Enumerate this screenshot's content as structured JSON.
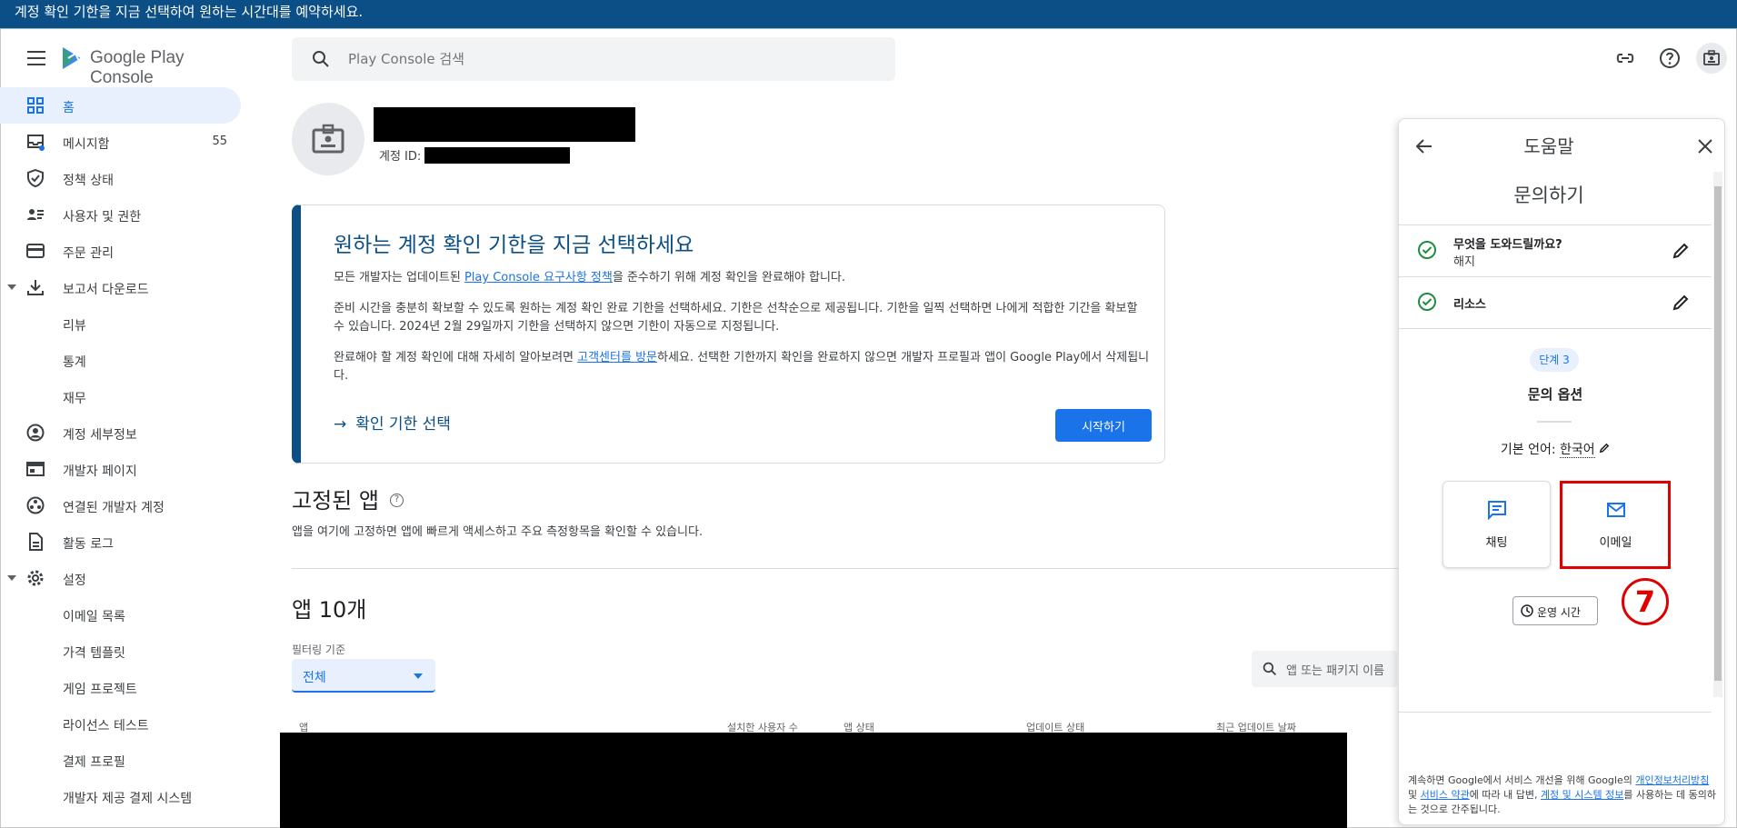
{
  "banner": {
    "text": "계정 확인 기한을 지금 선택하여 원하는 시간대를 예약하세요."
  },
  "brand": {
    "name": "Google Play Console"
  },
  "search": {
    "placeholder": "Play Console 검색"
  },
  "nav": [
    {
      "label": "홈",
      "icon": "home-grid-icon",
      "active": true
    },
    {
      "label": "메시지함",
      "icon": "inbox-icon",
      "count": "55"
    },
    {
      "label": "정책 상태",
      "icon": "shield-check-icon"
    },
    {
      "label": "사용자 및 권한",
      "icon": "users-icon"
    },
    {
      "label": "주문 관리",
      "icon": "card-icon"
    },
    {
      "label": "보고서 다운로드",
      "icon": "download-icon",
      "expandable": true
    },
    {
      "label": "리뷰",
      "sub": true
    },
    {
      "label": "통계",
      "sub": true
    },
    {
      "label": "재무",
      "sub": true
    },
    {
      "label": "계정 세부정보",
      "icon": "account-circle-icon"
    },
    {
      "label": "개발자 페이지",
      "icon": "web-page-icon"
    },
    {
      "label": "연결된 개발자 계정",
      "icon": "linked-accounts-icon"
    },
    {
      "label": "활동 로그",
      "icon": "log-icon"
    },
    {
      "label": "설정",
      "icon": "gear-icon",
      "expandable": true
    },
    {
      "label": "이메일 목록",
      "sub": true
    },
    {
      "label": "가격 템플릿",
      "sub": true
    },
    {
      "label": "게임 프로젝트",
      "sub": true
    },
    {
      "label": "라이선스 테스트",
      "sub": true
    },
    {
      "label": "결제 프로필",
      "sub": true
    },
    {
      "label": "개발자 제공 결제 시스템",
      "sub": true
    }
  ],
  "account": {
    "id_label": "계정 ID:"
  },
  "card": {
    "title": "원하는 계정 확인 기한을 지금 선택하세요",
    "p1_pre": "모든 개발자는 업데이트된 ",
    "p1_link": "Play Console 요구사항 정책",
    "p1_post": "을 준수하기 위해 계정 확인을 완료해야 합니다.",
    "p2": "준비 시간을 충분히 확보할 수 있도록 원하는 계정 확인 완료 기한을 선택하세요. 기한은 선착순으로 제공됩니다. 기한을 일찍 선택하면 나에게 적합한 기간을 확보할 수 있습니다. 2024년 2월 29일까지 기한을 선택하지 않으면 기한이 자동으로 지정됩니다.",
    "p3_pre": "완료해야 할 계정 확인에 대해 자세히 알아보려면 ",
    "p3_link": "고객센터를 방문",
    "p3_post": "하세요. 선택한 기한까지 확인을 완료하지 않으면 개발자 프로필과 앱이 Google Play에서 삭제됩니다.",
    "link": "확인 기한 선택",
    "button": "시작하기"
  },
  "pinned": {
    "title": "고정된 앱",
    "desc": "앱을 여기에 고정하면 앱에 빠르게 액세스하고 주요 측정항목을 확인할 수 있습니다."
  },
  "apps": {
    "title": "앱 10개",
    "filter_label": "필터링 기준",
    "filter_value": "전체",
    "search_placeholder": "앱 또는 패키지 이름",
    "columns": [
      "앱",
      "설치한 사용자 수",
      "앱 상태",
      "업데이트 상태",
      "최근 업데이트 날짜"
    ]
  },
  "help": {
    "title": "도움말",
    "subtitle": "문의하기",
    "steps": [
      {
        "title": "무엇을 도와드릴까요?",
        "value": "해지"
      },
      {
        "title": "리소스",
        "value": ""
      }
    ],
    "badge": "단계 3",
    "options_title": "문의 옵션",
    "lang_label": "기본 언어: ",
    "lang_value": "한국어",
    "chat_label": "채팅",
    "email_label": "이메일",
    "hours_label": "운영 시간",
    "footer_pre": "계속하면 Google에서 서비스 개선을 위해 Google의 ",
    "footer_link1": "개인정보처리방침",
    "footer_mid1": " 및 ",
    "footer_link2": "서비스 약관",
    "footer_mid2": "에 따라 내 답변, ",
    "footer_link3": "계정 및 시스템 정보",
    "footer_post": "를 사용하는 데 동의하는 것으로 간주됩니다."
  },
  "annotation": {
    "number": "7"
  },
  "colors": {
    "accent": "#1a73e8",
    "banner": "#0b4f86",
    "highlight": "#e00000"
  }
}
